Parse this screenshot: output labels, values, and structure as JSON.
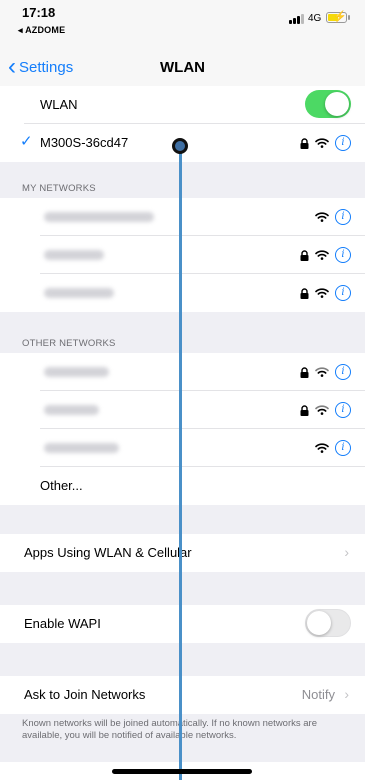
{
  "status_bar": {
    "time": "17:18",
    "back_app": "◂ AZDOME",
    "network": "4G"
  },
  "nav": {
    "back_label": "Settings",
    "title": "WLAN"
  },
  "wlan": {
    "label": "WLAN",
    "enabled": true,
    "connected_network": "M300S-36cd47"
  },
  "my_networks": {
    "header": "MY NETWORKS",
    "items": [
      {
        "secured": false
      },
      {
        "secured": true
      },
      {
        "secured": true
      }
    ]
  },
  "other_networks": {
    "header": "OTHER NETWORKS",
    "items": [
      {
        "secured": true
      },
      {
        "secured": true
      },
      {
        "secured": false
      }
    ],
    "other_label": "Other..."
  },
  "apps_using": {
    "label": "Apps Using WLAN & Cellular"
  },
  "wapi": {
    "label": "Enable WAPI",
    "enabled": false
  },
  "ask_to_join": {
    "label": "Ask to Join Networks",
    "value": "Notify",
    "footnote": "Known networks will be joined automatically. If no known networks are available, you will be notified of available networks."
  },
  "colors": {
    "accent": "#147efb",
    "toggle_on": "#4cd964",
    "background": "#efeff4"
  },
  "icons": [
    "back-chevron-icon",
    "checkmark-icon",
    "lock-icon",
    "wifi-icon",
    "info-icon",
    "chevron-right-icon"
  ]
}
